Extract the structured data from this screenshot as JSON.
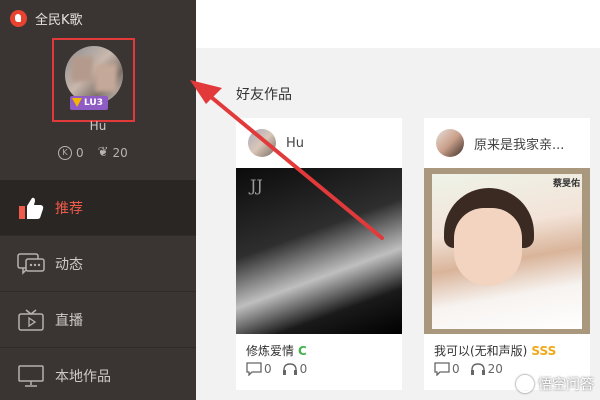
{
  "app": {
    "title": "全民K歌"
  },
  "profile": {
    "username": "Hu",
    "level": "LU3",
    "stats": {
      "k_coins": "0",
      "flowers": "20"
    }
  },
  "nav": {
    "items": [
      {
        "label": "推荐",
        "active": true,
        "icon": "thumbs-up-icon"
      },
      {
        "label": "动态",
        "active": false,
        "icon": "chat-bubble-icon"
      },
      {
        "label": "直播",
        "active": false,
        "icon": "tv-icon"
      },
      {
        "label": "本地作品",
        "active": false,
        "icon": "monitor-icon"
      }
    ]
  },
  "main": {
    "section_title": "好友作品",
    "cards": [
      {
        "user": "Hu",
        "song": "修炼爱情",
        "grade": "C",
        "comments": "0",
        "listens": "0"
      },
      {
        "user": "原来是我家亲...",
        "song": "我可以(无和声版)",
        "grade": "SSS",
        "comments": "0",
        "listens": "20"
      }
    ]
  },
  "colors": {
    "sidebar_bg": "#3a3533",
    "accent": "#ef5b4a",
    "annotation": "#e23a3a",
    "grade_c": "#41b34c",
    "grade_sss": "#f0a818"
  },
  "watermark": {
    "text": "悟空问答"
  }
}
